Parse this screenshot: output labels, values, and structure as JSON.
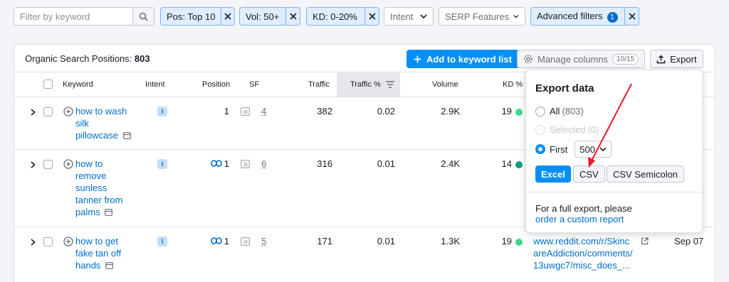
{
  "filters": {
    "search_placeholder": "Filter by keyword",
    "chips": [
      {
        "label": "Pos: Top 10"
      },
      {
        "label": "Vol: 50+"
      },
      {
        "label": "KD: 0-20%"
      }
    ],
    "intent": "Intent",
    "serp_features": "SERP Features",
    "advanced": "Advanced filters",
    "advanced_count": "1"
  },
  "card": {
    "title_prefix": "Organic Search Positions: ",
    "title_count": "803",
    "add_button": "Add to keyword list",
    "manage_columns": "Manage columns",
    "columns_count": "10/15",
    "export": "Export"
  },
  "table": {
    "headers": {
      "keyword": "Keyword",
      "intent": "Intent",
      "position": "Position",
      "sf": "SF",
      "traffic": "Traffic",
      "traffic_pct": "Traffic %",
      "volume": "Volume",
      "kd": "KD %"
    },
    "rows": [
      {
        "keyword_lines": [
          "how to wash",
          "silk",
          "pillowcase"
        ],
        "intent": "I",
        "position": "1",
        "sf": "4",
        "traffic": "382",
        "traffic_pct": "0.02",
        "volume": "2.9K",
        "kd": "19",
        "kd_color": "#3cd88e"
      },
      {
        "keyword_lines": [
          "how to",
          "remove",
          "sunless",
          "tanner from",
          "palms"
        ],
        "intent": "I",
        "position": "1",
        "sf": "6",
        "traffic": "316",
        "traffic_pct": "0.01",
        "volume": "2.4K",
        "kd": "14",
        "kd_color": "#009f81"
      },
      {
        "keyword_lines": [
          "how to get",
          "fake tan off",
          "hands"
        ],
        "intent": "I",
        "position": "1",
        "sf": "5",
        "traffic": "171",
        "traffic_pct": "0.01",
        "volume": "1.3K",
        "kd": "19",
        "kd_color": "#3cd88e",
        "url_lines": [
          "www.reddit.com/r/Skinc",
          "areAddiction/comments/",
          "13uwgc7/misc_does_..."
        ],
        "date": "Sep 07"
      }
    ]
  },
  "export_popup": {
    "title": "Export data",
    "all_label": "All",
    "all_count": "(803)",
    "selected_label": "Selected",
    "selected_count": "(0)",
    "first_label": "First",
    "first_value": "500",
    "formats": [
      "Excel",
      "CSV",
      "CSV Semicolon"
    ],
    "footer_text": "For a full export, please",
    "footer_link": "order a custom report"
  },
  "colors": {
    "accent": "#008ff8",
    "link": "#006dca",
    "annotation_arrow": "#e8192c"
  }
}
